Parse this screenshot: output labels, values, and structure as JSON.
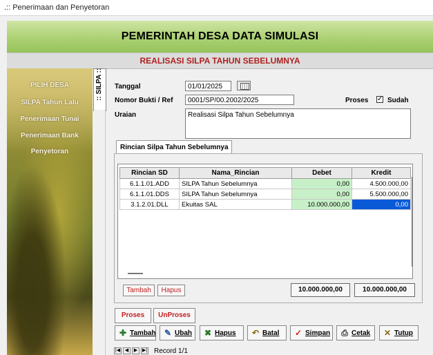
{
  "window": {
    "title": ".:: Penerimaan dan Penyetoran"
  },
  "header": {
    "title": "PEMERINTAH DESA DATA SIMULASI",
    "subtitle": "REALISASI SILPA TAHUN SEBELUMNYA"
  },
  "sidebar": {
    "items": [
      {
        "label": "PILIH DESA"
      },
      {
        "label": "SILPA Tahun Lalu"
      },
      {
        "label": "Penerimaan Tunai"
      },
      {
        "label": "Penerimaan Bank"
      },
      {
        "label": "Penyetoran"
      }
    ]
  },
  "vertical_tab": {
    "label": ":: SILPA ::"
  },
  "form": {
    "tanggal_label": "Tanggal",
    "tanggal_value": "01/01/2025",
    "nomor_label": "Nomor Bukti / Ref",
    "nomor_value": "0001/SP/00.2002/2025",
    "uraian_label": "Uraian",
    "uraian_value": "Realisasi Silpa Tahun Sebelumnya",
    "proses_label": "Proses",
    "sudah_label": "Sudah",
    "sudah_checked": "✓"
  },
  "detail_tab": {
    "label": "Rincian Silpa Tahun Sebelumnya"
  },
  "grid": {
    "columns": [
      "Rincian SD",
      "Nama_Rincian",
      "Debet",
      "Kredit"
    ],
    "rows": [
      [
        "6.1.1.01.ADD",
        "SILPA Tahun Sebelumnya",
        "0,00",
        "4.500.000,00"
      ],
      [
        "6.1.1.01.DDS",
        "SILPA Tahun Sebelumnya",
        "0,00",
        "5.500.000,00"
      ],
      [
        "3.1.2.01.DLL",
        "Ekuitas SAL",
        "10.000.000,00",
        "0,00"
      ]
    ]
  },
  "grid_buttons": {
    "tambah": "Tambah",
    "hapus": "Hapus"
  },
  "totals": {
    "debet": "10.000.000,00",
    "kredit": "10.000.000,00"
  },
  "process_buttons": {
    "proses": "Proses",
    "unproses": "UnProses"
  },
  "toolbar": [
    {
      "label": "Tambah",
      "icon": "add-icon"
    },
    {
      "label": "Ubah",
      "icon": "edit-icon"
    },
    {
      "label": "Hapus",
      "icon": "delete-icon"
    },
    {
      "label": "Batal",
      "icon": "cancel-icon"
    },
    {
      "label": "Simpan",
      "icon": "check-icon"
    },
    {
      "label": "Cetak",
      "icon": "printer-icon"
    },
    {
      "label": "Tutup",
      "icon": "close-icon"
    }
  ],
  "navigator": {
    "record_text": "Record 1/1"
  },
  "colors": {
    "banner_green": "#a9cf70",
    "subtitle_red": "#b02020",
    "selected_cell": "#0a5ad8",
    "debet_cell": "#c8f0c8"
  }
}
